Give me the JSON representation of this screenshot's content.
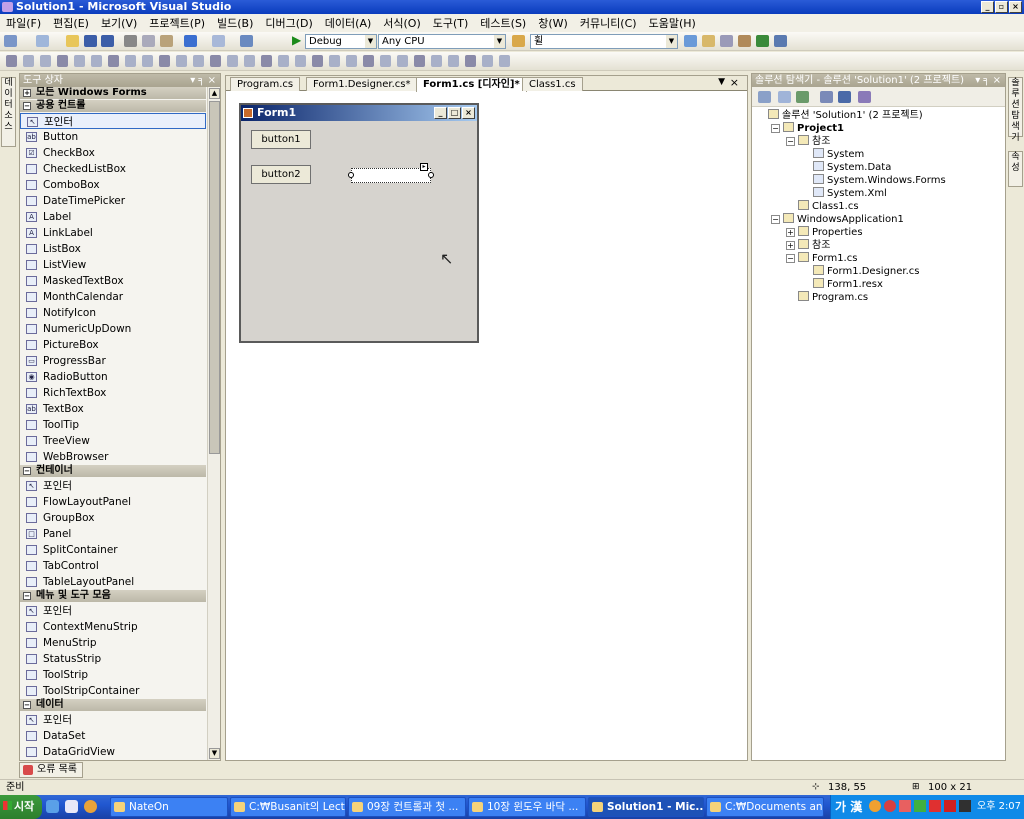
{
  "window": {
    "title": "Solution1 - Microsoft Visual Studio",
    "controls": [
      "_",
      "▫",
      "×"
    ]
  },
  "menu": [
    "파일(F)",
    "편집(E)",
    "보기(V)",
    "프로젝트(P)",
    "빌드(B)",
    "디버그(D)",
    "데이터(A)",
    "서식(O)",
    "도구(T)",
    "테스트(S)",
    "창(W)",
    "커뮤니티(C)",
    "도움말(H)"
  ],
  "toolbar": {
    "config": "Debug",
    "platform": "Any CPU",
    "find": "휠"
  },
  "left_strip": {
    "tab": "데이터 소스"
  },
  "toolbox": {
    "title": "도구 상자",
    "categories": [
      {
        "name": "모든 Windows Forms",
        "expanded": false,
        "items": []
      },
      {
        "name": "공용 컨트롤",
        "expanded": true,
        "items": [
          "포인터",
          "Button",
          "CheckBox",
          "CheckedListBox",
          "ComboBox",
          "DateTimePicker",
          "Label",
          "LinkLabel",
          "ListBox",
          "ListView",
          "MaskedTextBox",
          "MonthCalendar",
          "NotifyIcon",
          "NumericUpDown",
          "PictureBox",
          "ProgressBar",
          "RadioButton",
          "RichTextBox",
          "TextBox",
          "ToolTip",
          "TreeView",
          "WebBrowser"
        ]
      },
      {
        "name": "컨테이너",
        "expanded": true,
        "items": [
          "포인터",
          "FlowLayoutPanel",
          "GroupBox",
          "Panel",
          "SplitContainer",
          "TabControl",
          "TableLayoutPanel"
        ]
      },
      {
        "name": "메뉴 및 도구 모음",
        "expanded": true,
        "items": [
          "포인터",
          "ContextMenuStrip",
          "MenuStrip",
          "StatusStrip",
          "ToolStrip",
          "ToolStripContainer"
        ]
      },
      {
        "name": "데이터",
        "expanded": true,
        "items": [
          "포인터",
          "DataSet",
          "DataGridView"
        ]
      }
    ]
  },
  "tabs": [
    "Program.cs",
    "Form1.Designer.cs*",
    "Form1.cs [디자인]*",
    "Class1.cs"
  ],
  "active_tab": "Form1.cs [디자인]*",
  "designer": {
    "form_title": "Form1",
    "button1": "button1",
    "button2": "button2"
  },
  "solution_explorer": {
    "title": "솔루션 탐색기 - 솔루션 'Solution1' (2 프로젝트)",
    "nodes": [
      {
        "label": "솔루션 'Solution1' (2 프로젝트)",
        "level": 0,
        "toggle": ""
      },
      {
        "label": "Project1",
        "level": 1,
        "toggle": "−",
        "bold": true
      },
      {
        "label": "참조",
        "level": 2,
        "toggle": "−"
      },
      {
        "label": "System",
        "level": 3,
        "toggle": ""
      },
      {
        "label": "System.Data",
        "level": 3,
        "toggle": ""
      },
      {
        "label": "System.Windows.Forms",
        "level": 3,
        "toggle": ""
      },
      {
        "label": "System.Xml",
        "level": 3,
        "toggle": ""
      },
      {
        "label": "Class1.cs",
        "level": 2,
        "toggle": ""
      },
      {
        "label": "WindowsApplication1",
        "level": 1,
        "toggle": "−"
      },
      {
        "label": "Properties",
        "level": 2,
        "toggle": "+"
      },
      {
        "label": "참조",
        "level": 2,
        "toggle": "+"
      },
      {
        "label": "Form1.cs",
        "level": 2,
        "toggle": "−"
      },
      {
        "label": "Form1.Designer.cs",
        "level": 3,
        "toggle": ""
      },
      {
        "label": "Form1.resx",
        "level": 3,
        "toggle": ""
      },
      {
        "label": "Program.cs",
        "level": 2,
        "toggle": ""
      }
    ]
  },
  "right_strip": {
    "tabs": [
      "솔루션 탐색기",
      "속성"
    ]
  },
  "error_list": {
    "label": "오류 목록"
  },
  "status": {
    "text": "준비",
    "position": "138, 55",
    "size": "100 x 21"
  },
  "taskbar": {
    "start": "시작",
    "tasks": [
      "NateOn",
      "C:₩Busanit의 Lect...",
      "09장 컨트롤과 첫 ...",
      "10장 윈도우 바닥 ...",
      "Solution1 - Mic...",
      "C:₩Documents an..."
    ],
    "active_task": "Solution1 - Mic...",
    "ime": "가 漢",
    "clock": "오후 2:07"
  }
}
